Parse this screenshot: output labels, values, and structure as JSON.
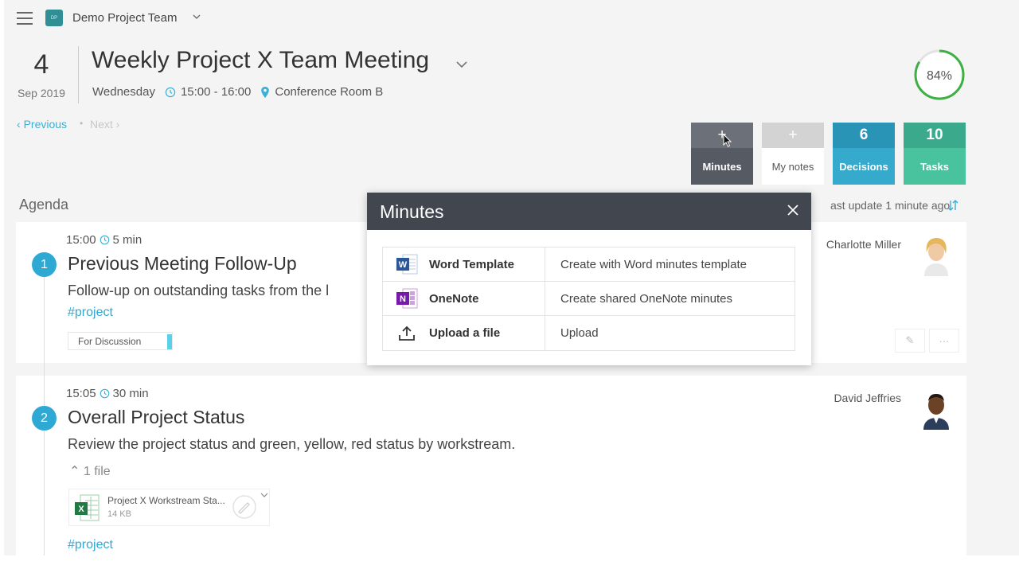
{
  "header": {
    "team_badge": "DP",
    "team_name": "Demo Project Team"
  },
  "meeting": {
    "day": "4",
    "month_year": "Sep 2019",
    "title": "Weekly Project X Team Meeting",
    "weekday": "Wednesday",
    "time_range": "15:00 - 16:00",
    "location": "Conference Room B",
    "progress_label": "84%",
    "progress_value": 0.84
  },
  "nav": {
    "previous": "Previous",
    "separator": "•",
    "next": "Next"
  },
  "counters": {
    "minutes": {
      "top": "+",
      "label": "Minutes"
    },
    "my_notes": {
      "top": "+",
      "label": "My notes"
    },
    "decisions": {
      "top": "6",
      "label": "Decisions"
    },
    "tasks": {
      "top": "10",
      "label": "Tasks"
    }
  },
  "agenda": {
    "heading": "Agenda",
    "last_update": "ast update 1 minute ago",
    "items": [
      {
        "number": "1",
        "start": "15:00",
        "duration": "5 min",
        "title": "Previous Meeting Follow-Up",
        "description": "Follow-up on outstanding tasks from the l",
        "tag": "#project",
        "status": "For Discussion",
        "presenter": "Charlotte Miller"
      },
      {
        "number": "2",
        "start": "15:05",
        "duration": "30 min",
        "title": "Overall Project Status",
        "description": "Review the project status and green, yellow, red status by workstream.",
        "files_toggle": "1 file",
        "file_name": "Project X Workstream Sta...",
        "file_size": "14 KB",
        "tag": "#project",
        "presenter": "David Jeffries"
      }
    ]
  },
  "modal": {
    "title": "Minutes",
    "rows": [
      {
        "icon": "word-icon",
        "name": "Word Template",
        "action": "Create with Word minutes template"
      },
      {
        "icon": "onenote-icon",
        "name": "OneNote",
        "action": "Create shared OneNote minutes"
      },
      {
        "icon": "upload-icon",
        "name": "Upload a file",
        "action": "Upload"
      }
    ]
  },
  "colors": {
    "accent": "#2ea9d4",
    "progress": "#3cb043",
    "decisions": "#2a94b6",
    "tasks": "#3aa98c",
    "modal_header": "#41464f"
  }
}
